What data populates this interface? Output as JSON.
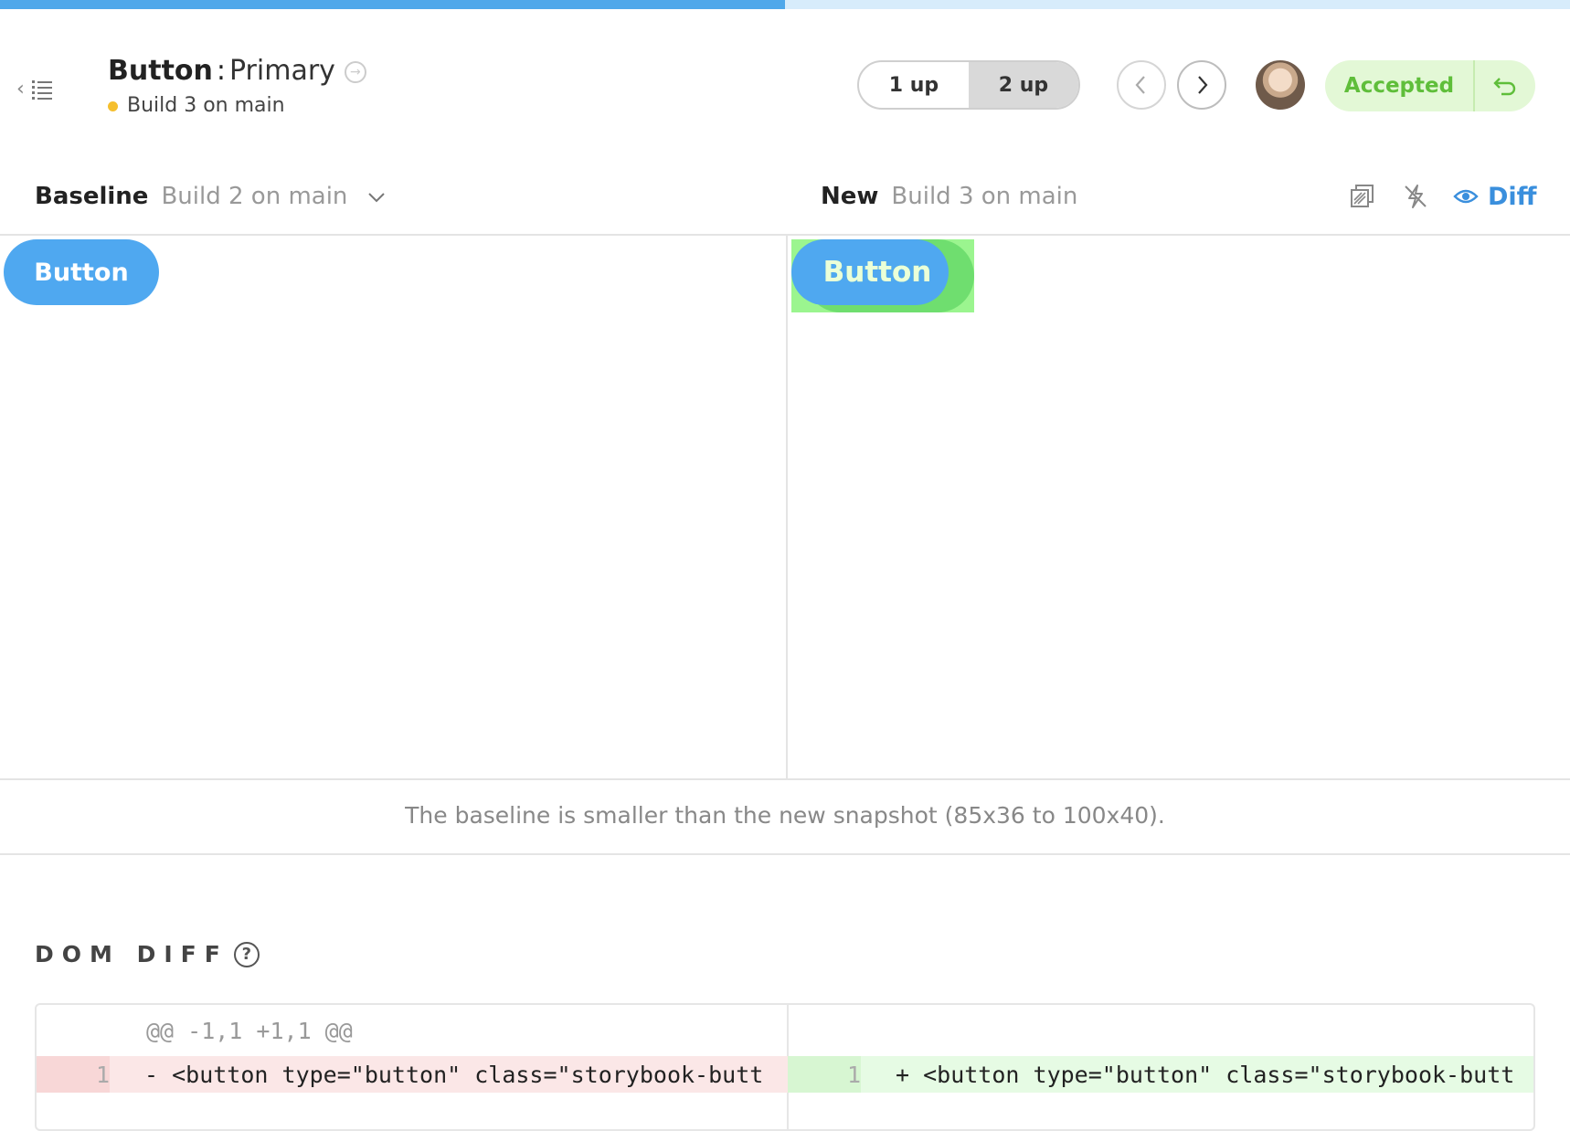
{
  "progress": {
    "fraction": 0.5
  },
  "header": {
    "component": "Button",
    "separator": ":",
    "story": "Primary",
    "build_status": "Build 3 on main",
    "view_options": [
      "1 up",
      "2 up"
    ],
    "view_selected": "2 up",
    "review_status": "Accepted"
  },
  "compare": {
    "baseline_label": "Baseline",
    "baseline_build": "Build 2 on main",
    "new_label": "New",
    "new_build": "Build 3 on main",
    "diff_label": "Diff"
  },
  "snapshots": {
    "baseline_button": "Button",
    "new_button": "Button"
  },
  "size_message": "The baseline is smaller than the new snapshot (85x36 to 100x40).",
  "dom_diff": {
    "title": "DOM DIFF",
    "hunk_header": "@@ -1,1 +1,1 @@",
    "removed": {
      "line": "1",
      "code": "- <button type=\"button\" class=\"storybook-butt"
    },
    "added": {
      "line": "1",
      "code": "+ <button type=\"button\" class=\"storybook-butt"
    }
  },
  "colors": {
    "accent": "#4fa8ea",
    "accepted_green": "#5fbe3a",
    "build_dot": "#f5bf2e",
    "diff_highlight": "#9bf58f"
  },
  "icons": [
    "chevron-left-icon",
    "list-icon",
    "arrow-circle-right-icon",
    "chevron-right-icon",
    "undo-icon",
    "chevron-down-icon",
    "compare-layers-icon",
    "strobe-off-icon",
    "eye-icon",
    "help-icon"
  ]
}
